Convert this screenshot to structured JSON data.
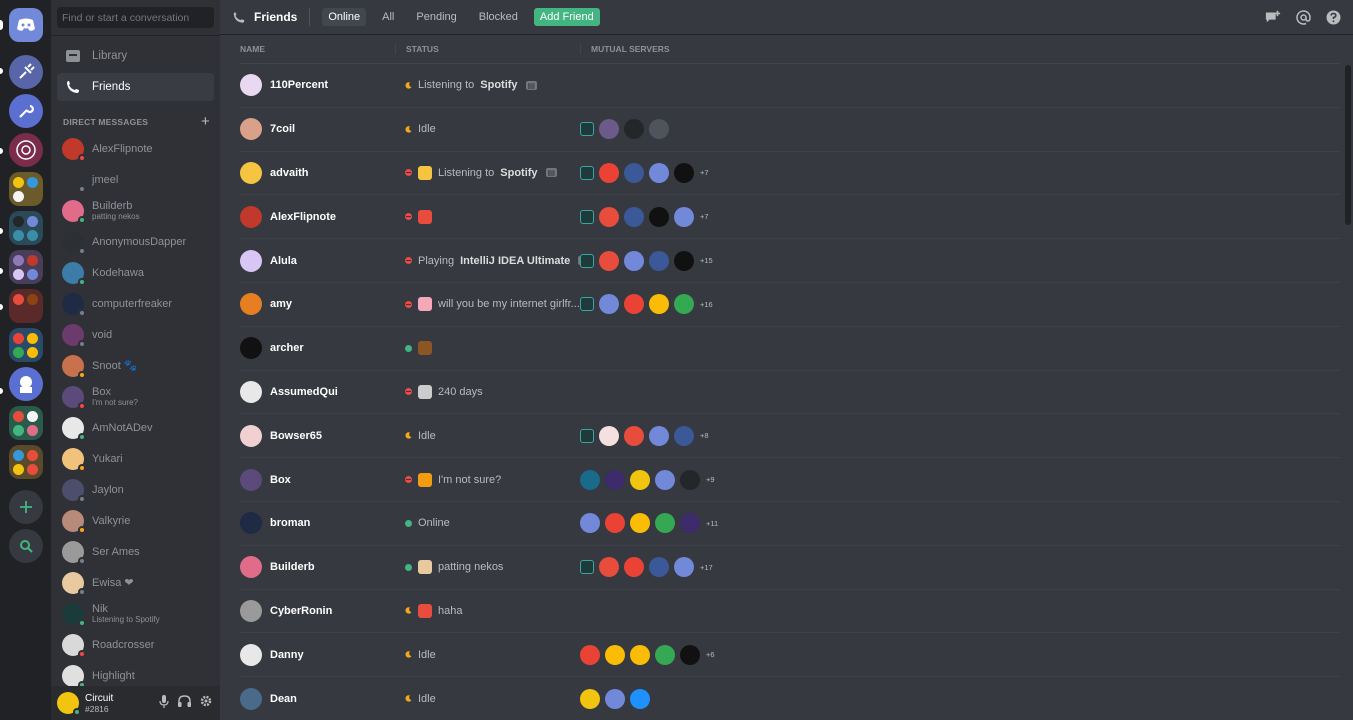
{
  "sidebar": {
    "search_placeholder": "Find or start a conversation",
    "nav": [
      {
        "label": "Library"
      },
      {
        "label": "Friends"
      }
    ],
    "dm_header": "DIRECT MESSAGES",
    "dms": [
      {
        "name": "AlexFlipnote",
        "sub": "",
        "status": "dnd",
        "color": "#c0392b"
      },
      {
        "name": "jmeel",
        "sub": "",
        "status": "off",
        "color": "#2f3136"
      },
      {
        "name": "Builderb",
        "sub": "patting nekos",
        "status": "online",
        "color": "#e06c8a"
      },
      {
        "name": "AnonymousDapper",
        "sub": "",
        "status": "off",
        "color": "#2c2f33"
      },
      {
        "name": "Kodehawa",
        "sub": "",
        "status": "online",
        "color": "#3b7ca8"
      },
      {
        "name": "computerfreaker",
        "sub": "",
        "status": "off",
        "color": "#1f2a44"
      },
      {
        "name": "void",
        "sub": "",
        "status": "off",
        "color": "#6b3b6e"
      },
      {
        "name": "Snoot 🐾",
        "sub": "",
        "status": "idle",
        "color": "#c9704c"
      },
      {
        "name": "Box",
        "sub": "I'm not sure?",
        "status": "dnd",
        "color": "#5b4a7a"
      },
      {
        "name": "AmNotADev",
        "sub": "",
        "status": "online",
        "color": "#e8e8e8"
      },
      {
        "name": "Yukari",
        "sub": "",
        "status": "idle",
        "color": "#f0c27b"
      },
      {
        "name": "Jaylon",
        "sub": "",
        "status": "off",
        "color": "#4b4f6b"
      },
      {
        "name": "Valkyrie",
        "sub": "",
        "status": "idle",
        "color": "#b88a7a"
      },
      {
        "name": "Ser Ames",
        "sub": "",
        "status": "off",
        "color": "#9a9a9a"
      },
      {
        "name": "Ewisa ❤",
        "sub": "",
        "status": "off",
        "color": "#e8c9a0"
      },
      {
        "name": "Nik",
        "sub": "Listening to Spotify",
        "status": "online",
        "color": "#1b3b3a"
      },
      {
        "name": "Roadcrosser",
        "sub": "",
        "status": "dnd",
        "color": "#d9d9d9"
      },
      {
        "name": "Highlight",
        "sub": "",
        "status": "online",
        "color": "#e0e0e0"
      }
    ],
    "user": {
      "name": "Circuit",
      "tag": "#2816"
    }
  },
  "topbar": {
    "title": "Friends",
    "tabs": [
      "Online",
      "All",
      "Pending",
      "Blocked"
    ],
    "add_friend": "Add Friend"
  },
  "columns": {
    "name": "NAME",
    "status": "STATUS",
    "servers": "MUTUAL SERVERS"
  },
  "friends": [
    {
      "name": "110Percent",
      "status": "idle",
      "text": "Listening to ",
      "bold": "Spotify",
      "rp": true,
      "emoji": "",
      "avatar": "#e8d9f0",
      "servers": [],
      "more": ""
    },
    {
      "name": "7coil",
      "status": "idle",
      "text": "Idle",
      "bold": "",
      "rp": false,
      "emoji": "",
      "avatar": "#d9a08a",
      "servers": [
        "#1e3a3a",
        "#6b5a8a",
        "#23272a",
        "#4f545c"
      ],
      "more": ""
    },
    {
      "name": "advaith",
      "status": "dnd",
      "text": "Listening to ",
      "bold": "Spotify",
      "rp": true,
      "emoji": "#f5c542",
      "avatar": "#f5c542",
      "servers": [
        "#1e3a3a",
        "#ea4335",
        "#3b5998",
        "#7289da",
        "#111111"
      ],
      "more": "+7"
    },
    {
      "name": "AlexFlipnote",
      "status": "dnd",
      "text": "",
      "bold": "",
      "rp": false,
      "emoji": "#e74c3c",
      "avatar": "#c0392b",
      "servers": [
        "#1e3a3a",
        "#e74c3c",
        "#3b5998",
        "#111111",
        "#7289da"
      ],
      "more": "+7"
    },
    {
      "name": "Alula",
      "status": "dnd",
      "text": "Playing ",
      "bold": "IntelliJ IDEA Ultimate",
      "rp": true,
      "emoji": "",
      "avatar": "#d8c7f5",
      "servers": [
        "#1e3a3a",
        "#e74c3c",
        "#7289da",
        "#3b5998",
        "#111111"
      ],
      "more": "+15"
    },
    {
      "name": "amy",
      "status": "dnd",
      "text": "will you be my internet girlfr...",
      "bold": "",
      "rp": false,
      "emoji": "#f5a9b8",
      "avatar": "#e67e22",
      "servers": [
        "#1e3a3a",
        "#7289da",
        "#ea4335",
        "#fbbc05",
        "#34a853"
      ],
      "more": "+16"
    },
    {
      "name": "archer",
      "status": "online",
      "text": "",
      "bold": "",
      "rp": false,
      "emoji": "#8d5524",
      "avatar": "#111111",
      "servers": [],
      "more": ""
    },
    {
      "name": "AssumedQui",
      "status": "dnd",
      "text": "240 days",
      "bold": "",
      "rp": false,
      "emoji": "#cccccc",
      "avatar": "#e8e8e8",
      "servers": [],
      "more": ""
    },
    {
      "name": "Bowser65",
      "status": "idle",
      "text": "Idle",
      "bold": "",
      "rp": false,
      "emoji": "",
      "avatar": "#f0d0d0",
      "servers": [
        "#1e3a3a",
        "#f5e0e0",
        "#e74c3c",
        "#7289da",
        "#3b5998"
      ],
      "more": "+8"
    },
    {
      "name": "Box",
      "status": "dnd",
      "text": "I'm not sure?",
      "bold": "",
      "rp": false,
      "emoji": "#f39c12",
      "avatar": "#5b4a7a",
      "servers": [
        "#1a6a8a",
        "#3d2b6b",
        "#f1c40f",
        "#7289da",
        "#23272a"
      ],
      "more": "+9"
    },
    {
      "name": "broman",
      "status": "online",
      "text": "Online",
      "bold": "",
      "rp": false,
      "emoji": "",
      "avatar": "#1f2a44",
      "servers": [
        "#7289da",
        "#ea4335",
        "#fbbc05",
        "#34a853",
        "#3d2b6b"
      ],
      "more": "+11"
    },
    {
      "name": "Builderb",
      "status": "online",
      "text": "patting nekos",
      "bold": "",
      "rp": false,
      "emoji": "#e8c9a0",
      "avatar": "#e06c8a",
      "servers": [
        "#1e3a3a",
        "#e74c3c",
        "#ea4335",
        "#3b5998",
        "#7289da"
      ],
      "more": "+17"
    },
    {
      "name": "CyberRonin",
      "status": "idle",
      "text": "haha",
      "bold": "",
      "rp": false,
      "emoji": "#e74c3c",
      "avatar": "#9a9a9a",
      "servers": [],
      "more": ""
    },
    {
      "name": "Danny",
      "status": "idle",
      "text": "Idle",
      "bold": "",
      "rp": false,
      "emoji": "",
      "avatar": "#e8e8e8",
      "servers": [
        "#ea4335",
        "#fbbc05",
        "#fbbc05",
        "#34a853",
        "#111111"
      ],
      "more": "+6"
    },
    {
      "name": "Dean",
      "status": "idle",
      "text": "Idle",
      "bold": "",
      "rp": false,
      "emoji": "",
      "avatar": "#4a6a8a",
      "servers": [
        "#f1c40f",
        "#7289da",
        "#1e90ff"
      ],
      "more": ""
    }
  ]
}
